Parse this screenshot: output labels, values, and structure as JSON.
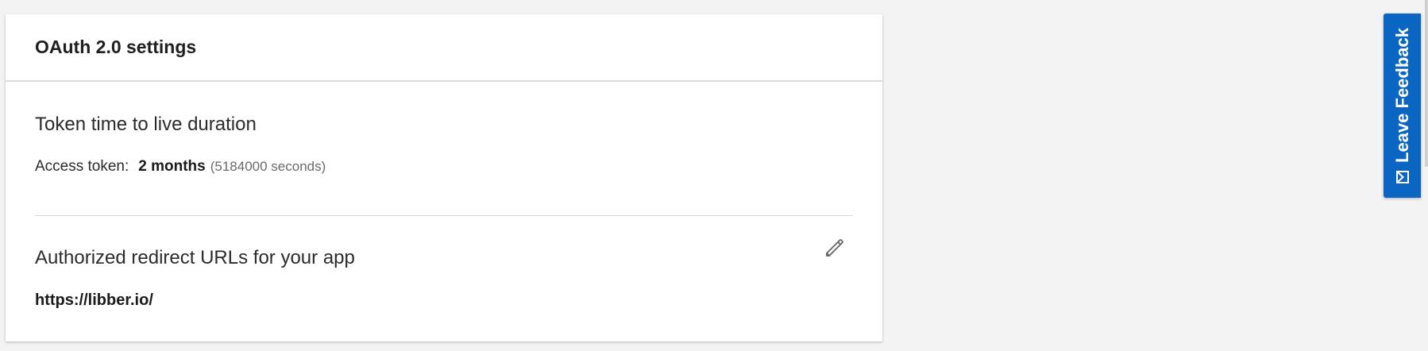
{
  "card": {
    "title": "OAuth 2.0 settings"
  },
  "token_section": {
    "title": "Token time to live duration",
    "access_label": "Access token:",
    "access_value": "2 months",
    "access_seconds": "(5184000 seconds)"
  },
  "redirect_section": {
    "title": "Authorized redirect URLs for your app",
    "url": "https://libber.io/",
    "edit_icon": "pencil-icon"
  },
  "feedback": {
    "label": "Leave Feedback",
    "icon": "feedback-icon",
    "color": "#0a66c2"
  }
}
